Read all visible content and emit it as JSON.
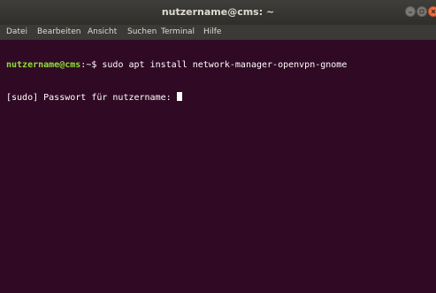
{
  "window": {
    "title": "nutzername@cms: ~"
  },
  "menubar": {
    "items": [
      "Datei",
      "Bearbeiten",
      "Ansicht",
      "Suchen",
      "Terminal",
      "Hilfe"
    ]
  },
  "terminal": {
    "prompt_user_host": "nutzername@cms",
    "prompt_suffix": ":~$ ",
    "command": "sudo apt install network-manager-openvpn-gnome",
    "sudo_prompt": "[sudo] Passwort für nutzername: "
  },
  "colors": {
    "background": "#300a24",
    "prompt_user": "#8ae234",
    "text": "#ffffff",
    "close_button": "#ef6f3d"
  }
}
